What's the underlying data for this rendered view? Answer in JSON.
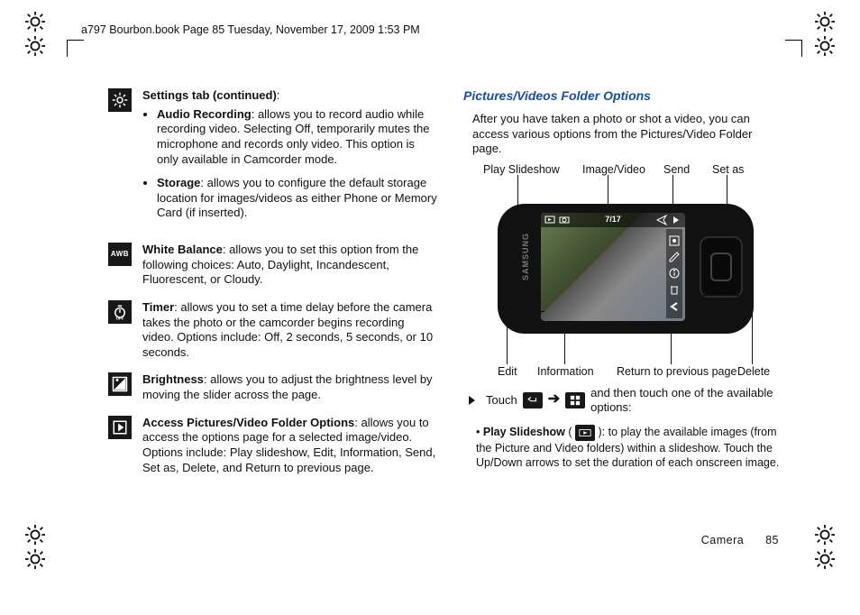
{
  "header": "a797 Bourbon.book  Page 85  Tuesday, November 17, 2009  1:53 PM",
  "left": {
    "settings_heading": "Settings tab (continued)",
    "audio_title": "Audio Recording",
    "audio_body": ": allows you to record audio while recording video. Selecting Off, temporarily mutes the microphone and records only video. This option is only available in Camcorder mode.",
    "storage_title": "Storage",
    "storage_body": ": allows you to configure the default storage location for images/videos as either Phone or Memory Card (if inserted).",
    "wb_title": "White Balance",
    "wb_body": ": allows you to set this option from the following choices: Auto, Daylight, Incandescent, Fluorescent, or Cloudy.",
    "timer_title": "Timer",
    "timer_body": ": allows you to set a time delay before the camera takes the photo or the camcorder begins recording video. Options include: Off, 2 seconds, 5 seconds, or 10 seconds.",
    "bright_title": "Brightness",
    "bright_body": ": allows you to adjust the brightness level by moving the slider across the page.",
    "folder_title": "Access Pictures/Video Folder Options",
    "folder_body": ": allows you to access the options page for a selected image/video. Options include: Play slideshow, Edit, Information, Send, Set as, Delete, and Return to previous page."
  },
  "right": {
    "section_title": "Pictures/Videos Folder Options",
    "intro": "After you have taken a photo or shot a video, you can access various options from the Pictures/Video Folder page.",
    "labels": {
      "top1": "Play Slideshow",
      "top2": "Image/Video",
      "top3": "Send",
      "top4": "Set as",
      "bot1": "Edit",
      "bot2": "Information",
      "bot3": "Return to previous page",
      "bot4": "Delete"
    },
    "counter": "7/17",
    "touch_pre": "Touch",
    "touch_post": "and then touch one of the available options:",
    "play_title": "Play Slideshow",
    "play_body": "): to play the available images (from the Picture and Video folders) within a slideshow. Touch the Up/Down arrows to set the duration of each onscreen image.",
    "brand1": "SAMSUNG"
  },
  "footer": {
    "section": "Camera",
    "page": "85"
  }
}
